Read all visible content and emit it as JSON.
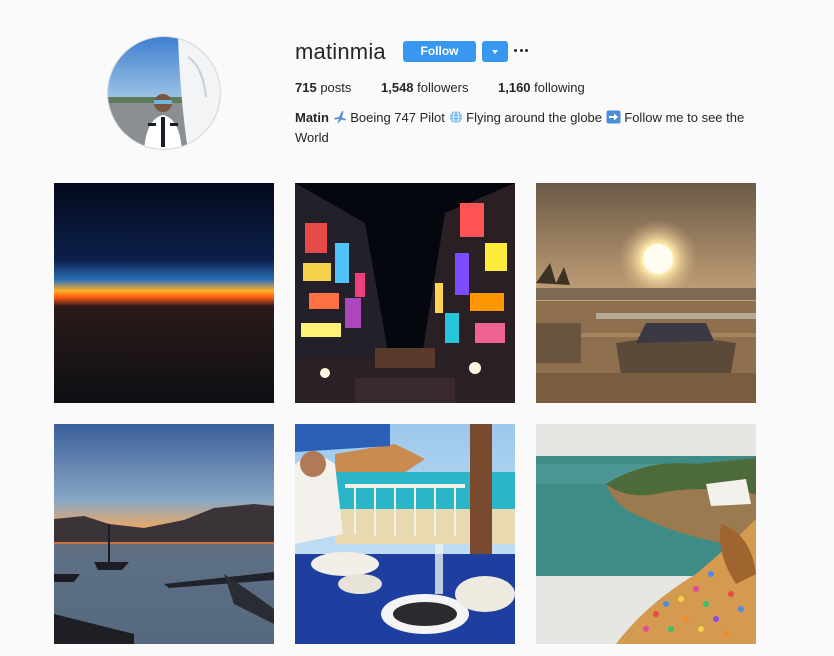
{
  "profile": {
    "username": "matinmia",
    "follow_label": "Follow",
    "avatar_icon": "profile-avatar-pilot"
  },
  "stats": {
    "posts": {
      "count": "715",
      "label": "posts"
    },
    "followers": {
      "count": "1,548",
      "label": "followers"
    },
    "following": {
      "count": "1,160",
      "label": "following"
    }
  },
  "bio": {
    "name": "Matin",
    "part1": "Boeing 747 Pilot",
    "part2": "Flying around the globe",
    "part3": "Follow me to see the World",
    "icons": [
      "airplane-emoji",
      "globe-emoji",
      "right-arrow-emoji"
    ]
  },
  "posts": [
    {
      "id": 1,
      "icon": "sunset-horizon-photo"
    },
    {
      "id": 2,
      "icon": "city-night-street-photo"
    },
    {
      "id": 3,
      "icon": "harbor-sunset-photo"
    },
    {
      "id": 4,
      "icon": "river-boats-dusk-photo"
    },
    {
      "id": 5,
      "icon": "seaside-dinner-photo"
    },
    {
      "id": 6,
      "icon": "beach-cliffs-photo"
    }
  ],
  "colors": {
    "primary_button": "#3897f0",
    "background": "#fafafa",
    "text": "#262626"
  }
}
